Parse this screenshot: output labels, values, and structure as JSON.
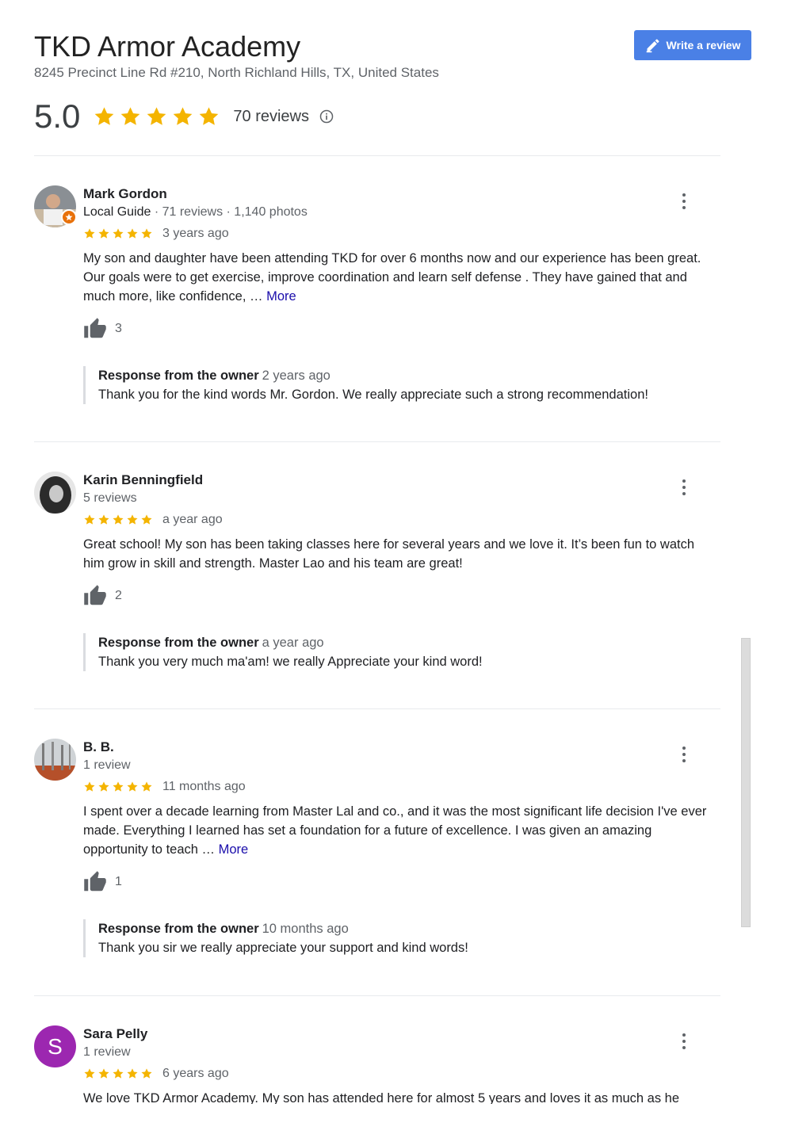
{
  "business": {
    "name": "TKD Armor Academy",
    "address": "8245 Precinct Line Rd #210, North Richland Hills, TX, United States",
    "rating": "5.0",
    "stars": 5,
    "review_count": "70 reviews"
  },
  "actions": {
    "write_review": "Write a review"
  },
  "colors": {
    "accent": "#4a80e6",
    "star": "#f4b400",
    "link": "#1a0dab"
  },
  "reviews": [
    {
      "name": "Mark Gordon",
      "meta_guide": "Local Guide",
      "meta_rest": " · 71 reviews · 1,140 photos",
      "stars": 5,
      "time": "3 years ago",
      "text": "My son and daughter have been attending TKD for over 6 months now and our experience has been great. Our goals were to get exercise, improve coordination and learn self defense . They have gained that and much more, like confidence, …",
      "more": "More",
      "likes": "3",
      "response_label": "Response from the owner",
      "response_time": "2 years ago",
      "response_text": "Thank you for the kind words Mr. Gordon. We really appreciate such a strong recommendation!"
    },
    {
      "name": "Karin Benningfield",
      "meta": "5 reviews",
      "stars": 5,
      "time": "a year ago",
      "text": "Great school!  My son has been taking classes here for several years and we love it. It’s been fun to watch him grow in skill and strength.  Master Lao and his team are great!",
      "likes": "2",
      "response_label": "Response from the owner",
      "response_time": "a year ago",
      "response_text": "Thank you very much ma'am! we really Appreciate your kind word!"
    },
    {
      "name": "B. B.",
      "meta": "1 review",
      "stars": 5,
      "time": "11 months ago",
      "text": "I spent over a decade learning from Master Lal and co., and it was the most significant life decision I've ever made. Everything I learned has set a foundation for a future of excellence. I was given an amazing opportunity to teach …",
      "more": "More",
      "likes": "1",
      "response_label": "Response from the owner",
      "response_time": "10 months ago",
      "response_text": "Thank you sir we really appreciate your support and kind words!"
    },
    {
      "name": "Sara Pelly",
      "avatar_letter": "S",
      "meta": "1 review",
      "stars": 5,
      "time": "6 years ago",
      "text": "We love TKD Armor Academy.   My son has attended here for almost 5 years and loves it as much as he"
    }
  ]
}
